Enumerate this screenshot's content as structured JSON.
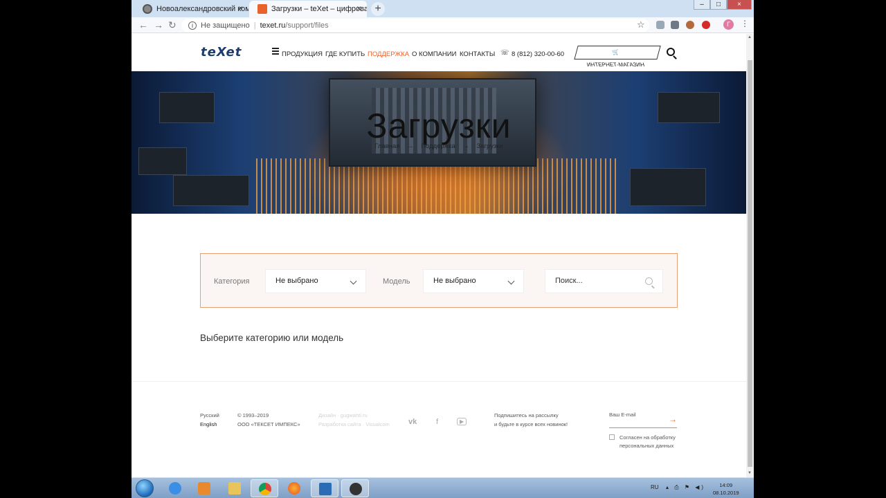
{
  "browser": {
    "tabs": [
      {
        "title": "Новоалександровский комплекс",
        "close": "×"
      },
      {
        "title": "Загрузки – teXet – цифровая техника",
        "close": "×"
      }
    ],
    "new_tab": "+",
    "window_controls": {
      "minimize": "–",
      "maximize": "□",
      "close": "×"
    },
    "nav": {
      "back": "←",
      "forward": "→",
      "reload": "↻"
    },
    "security_label": "Не защищено",
    "url_host": "texet.ru",
    "url_path": "/support/files",
    "star": "☆",
    "profile_initial": "Г",
    "menu": "⋮"
  },
  "header": {
    "logo": "teXet",
    "nav": [
      "ПРОДУКЦИЯ",
      "ГДЕ КУПИТЬ",
      "ПОДДЕРЖКА",
      "О КОМПАНИИ",
      "КОНТАКТЫ"
    ],
    "active_nav": "ПОДДЕРЖКА",
    "phone": "8 (812) 320-00-60",
    "phone_icon": "☏",
    "shop_label": "ИНТЕРНЕТ-МАГАЗИН"
  },
  "hero": {
    "title": "Загрузки",
    "breadcrumb": [
      "Главная",
      "Поддержка",
      "Загрузки"
    ],
    "breadcrumb_sep": "→"
  },
  "filter": {
    "category_label": "Категория",
    "category_value": "Не выбрано",
    "model_label": "Модель",
    "model_value": "Не выбрано",
    "search_placeholder": "Поиск..."
  },
  "empty_message": "Выберите категорию или модель",
  "footer": {
    "lang_ru": "Русский",
    "lang_en": "English",
    "copyright": "© 1993–2019",
    "company": "ООО «ТЕКСЕТ ИМПЕКС»",
    "design": "Дизайн · gugwahti.ru",
    "dev": "Разработка сайта · Visualcom",
    "social": [
      "vk",
      "f",
      "▶"
    ],
    "subscribe_line1": "Подпишитесь на рассылку",
    "subscribe_line2": "и будьте в курсе всех новинок!",
    "email_placeholder": "Ваш E-mail",
    "submit_arrow": "→",
    "agree_line1": "Согласен на обработку",
    "agree_line2": "персональных данных"
  },
  "taskbar": {
    "lang": "RU",
    "tray_icons": "▴ ⎙ ⚑ ◀)",
    "time": "14:09",
    "date": "08.10.2019"
  },
  "colors": {
    "accent": "#e9622b",
    "logo_blue": "#1e3c6e",
    "tab_strip": "#cfe0f2"
  }
}
